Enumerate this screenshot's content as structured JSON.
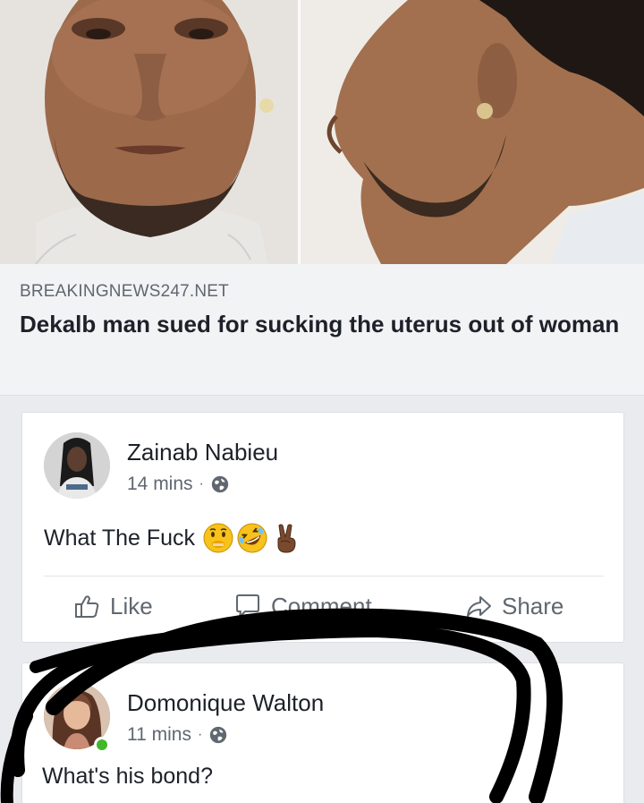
{
  "link_preview": {
    "domain": "BREAKINGNEWS247.NET",
    "headline": "Dekalb man sued for sucking the uterus out of woman"
  },
  "comments": [
    {
      "author": "Zainab Nabieu",
      "time": "14 mins",
      "separator": "·",
      "text": "What The Fuck",
      "emojis": [
        "hushed-face-icon",
        "rolling-laughing-icon",
        "victory-hand-icon"
      ],
      "online": false
    },
    {
      "author": "Domonique Walton",
      "time": "11 mins",
      "separator": "·",
      "text": "What's his bond?",
      "online": true
    }
  ],
  "actions": {
    "like_label": "Like",
    "comment_label": "Comment",
    "share_label": "Share"
  },
  "colors": {
    "background": "#e9ebee",
    "online": "#42b72a",
    "marker": "#000000",
    "secondary_text": "#606770"
  }
}
